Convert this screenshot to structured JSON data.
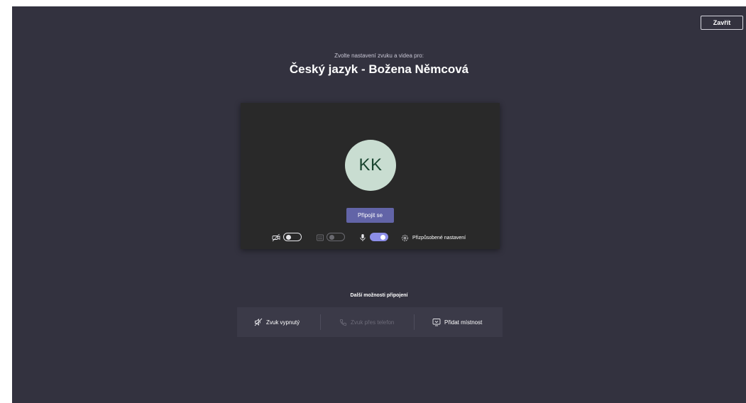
{
  "header": {
    "close_label": "Zavřít"
  },
  "meeting": {
    "subtitle": "Zvolte nastavení zvuku a videa pro:",
    "title": "Český jazyk - Božena Němcová"
  },
  "preview": {
    "avatar_initials": "KK",
    "join_label": "Připojit se",
    "camera_enabled": false,
    "blur_enabled": false,
    "blur_available": false,
    "mic_enabled": true,
    "custom_settings_label": "Přizpůsobené nastavení"
  },
  "more_options": {
    "title": "Další možnosti připojení",
    "items": [
      {
        "label": "Zvuk vypnutý",
        "icon": "speaker-off-icon",
        "enabled": true
      },
      {
        "label": "Zvuk přes telefon",
        "icon": "phone-icon",
        "enabled": false
      },
      {
        "label": "Přidat místnost",
        "icon": "room-icon",
        "enabled": true
      }
    ]
  },
  "colors": {
    "background": "#33323f",
    "preview_background": "#292929",
    "accent": "#6264a7",
    "toggle_on": "#8c8ee8",
    "avatar_background": "#c9ddd1",
    "avatar_text": "#19452f"
  }
}
